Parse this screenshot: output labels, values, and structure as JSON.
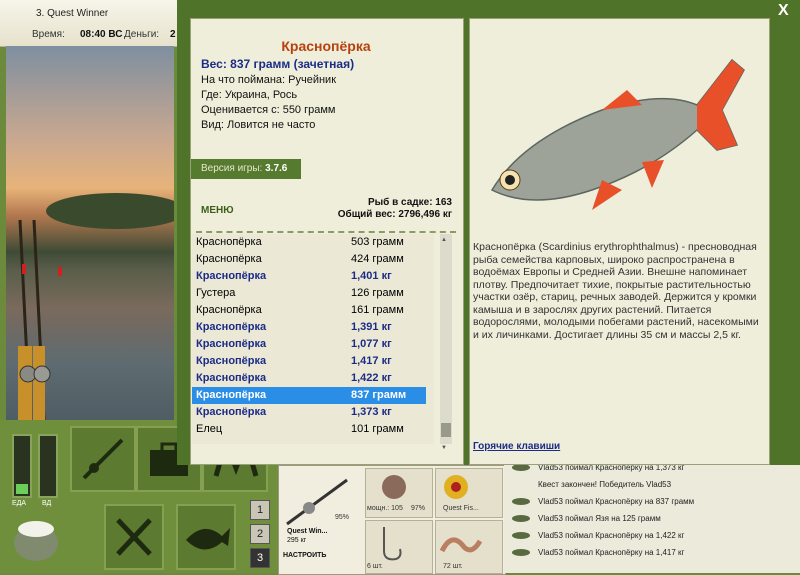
{
  "window": {
    "title": "3. Quest Winner"
  },
  "status": {
    "time_label": "Время:",
    "time_value": "08:40 ВС",
    "money_label": "Деньги:",
    "money_value": "2"
  },
  "dialog": {
    "close_label": "X",
    "fish_name": "Краснопёрка",
    "weight": "Вес: 837 грамм (зачетная)",
    "caught_on": "На что поймана: Ручейник",
    "where": "Где: Украина, Рось",
    "valued_from": "Оценивается с: 550 грамм",
    "kind": "Вид: Ловится не часто",
    "version_label": "Версия игры:",
    "version_value": "3.7.6",
    "menu_label": "МЕНЮ",
    "keepnet_count": "Рыб в садке: 163",
    "total_weight": "Общий вес: 2796,496 кг",
    "catch_list": [
      {
        "name": "Краснопёрка",
        "weight": "503 грамм",
        "bold": false,
        "selected": false
      },
      {
        "name": "Краснопёрка",
        "weight": "424 грамм",
        "bold": false,
        "selected": false
      },
      {
        "name": "Краснопёрка",
        "weight": "1,401 кг",
        "bold": true,
        "selected": false
      },
      {
        "name": "Густера",
        "weight": "126 грамм",
        "bold": false,
        "selected": false
      },
      {
        "name": "Краснопёрка",
        "weight": "161 грамм",
        "bold": false,
        "selected": false
      },
      {
        "name": "Краснопёрка",
        "weight": "1,391 кг",
        "bold": true,
        "selected": false
      },
      {
        "name": "Краснопёрка",
        "weight": "1,077 кг",
        "bold": true,
        "selected": false
      },
      {
        "name": "Краснопёрка",
        "weight": "1,417 кг",
        "bold": true,
        "selected": false
      },
      {
        "name": "Краснопёрка",
        "weight": "1,422 кг",
        "bold": true,
        "selected": false
      },
      {
        "name": "Краснопёрка",
        "weight": "837 грамм",
        "bold": true,
        "selected": true
      },
      {
        "name": "Краснопёрка",
        "weight": "1,373 кг",
        "bold": true,
        "selected": false
      },
      {
        "name": "Елец",
        "weight": "101 грамм",
        "bold": false,
        "selected": false
      }
    ],
    "description": "Краснопёрка (Scardinius erythrophthalmus) - пресноводная рыба семейства карповых, широко распространена в водоёмах Европы и Средней Азии. Внешне напоминает плотву. Предпочитает тихие, покрытые растительностью участки озёр, стариц, речных заводей. Держится у кромки камыша и в зарослях других растений. Питается водорослями, молодыми побегами растений, насекомыми и их личинками. Достигает длины 35 см и массы 2,5 кг.",
    "hotkeys_label": "Горячие клавиши"
  },
  "controls": {
    "food_label": "ЕДА",
    "drink_label": "ВД",
    "slot_buttons": [
      "1",
      "2",
      "3"
    ]
  },
  "tackle": {
    "rod_name": "Quest Win...",
    "rod_weight": "295 кг",
    "rod_percent": "95%",
    "setup_label": "НАСТРОИТЬ",
    "reel_label": "мощн.: 105",
    "reel_percent": "97%",
    "line_label": "Quest Fis...",
    "hooks_count": "6 шт.",
    "bait_count": "72 шт."
  },
  "chat": {
    "messages": [
      "Vlad53 поймал Краснопёрку на 1,373 кг",
      "Квест закончен! Победитель Vlad53",
      "Vlad53 поймал Краснопёрку на 837 грамм",
      "Vlad53 поймал Язя на 125 грамм",
      "Vlad53 поймал Краснопёрку на 1,422 кг",
      "Vlad53 поймал Краснопёрку на 1,417 кг"
    ]
  },
  "colors": {
    "dialog_bg": "#4f7329",
    "accent_red": "#b7410f",
    "accent_blue": "#1c2c86",
    "selection": "#2b8ee6"
  }
}
